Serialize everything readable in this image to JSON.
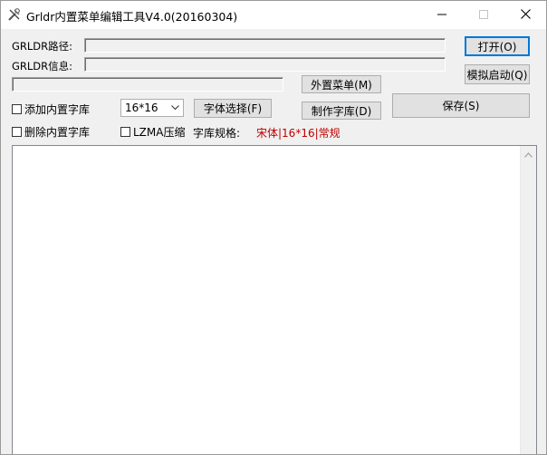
{
  "window": {
    "title": "Grldr内置菜单编辑工具V4.0(20160304)"
  },
  "fields": {
    "grldr_path_label": "GRLDR路径:",
    "grldr_info_label": "GRLDR信息:"
  },
  "buttons": {
    "open": "打开(O)",
    "simulate_boot": "模拟启动(Q)",
    "external_menu": "外置菜单(M)",
    "font_select": "字体选择(F)",
    "make_font_lib": "制作字库(D)",
    "save": "保存(S)"
  },
  "options": {
    "add_builtin_font": "添加内置字库",
    "delete_builtin_font": "删除内置字库",
    "lzma_compress": "LZMA压缩",
    "font_size_selected": "16*16"
  },
  "font_spec": {
    "label": "字库规格:",
    "value": "宋体|16*16|常规",
    "value_color": "#c00000"
  },
  "icons": {
    "app": "tools-icon",
    "minimize": "minimize-icon",
    "maximize": "maximize-icon",
    "close": "close-icon",
    "dropdown": "chevron-down-icon",
    "scroll_up": "scroll-up-arrow-icon"
  }
}
